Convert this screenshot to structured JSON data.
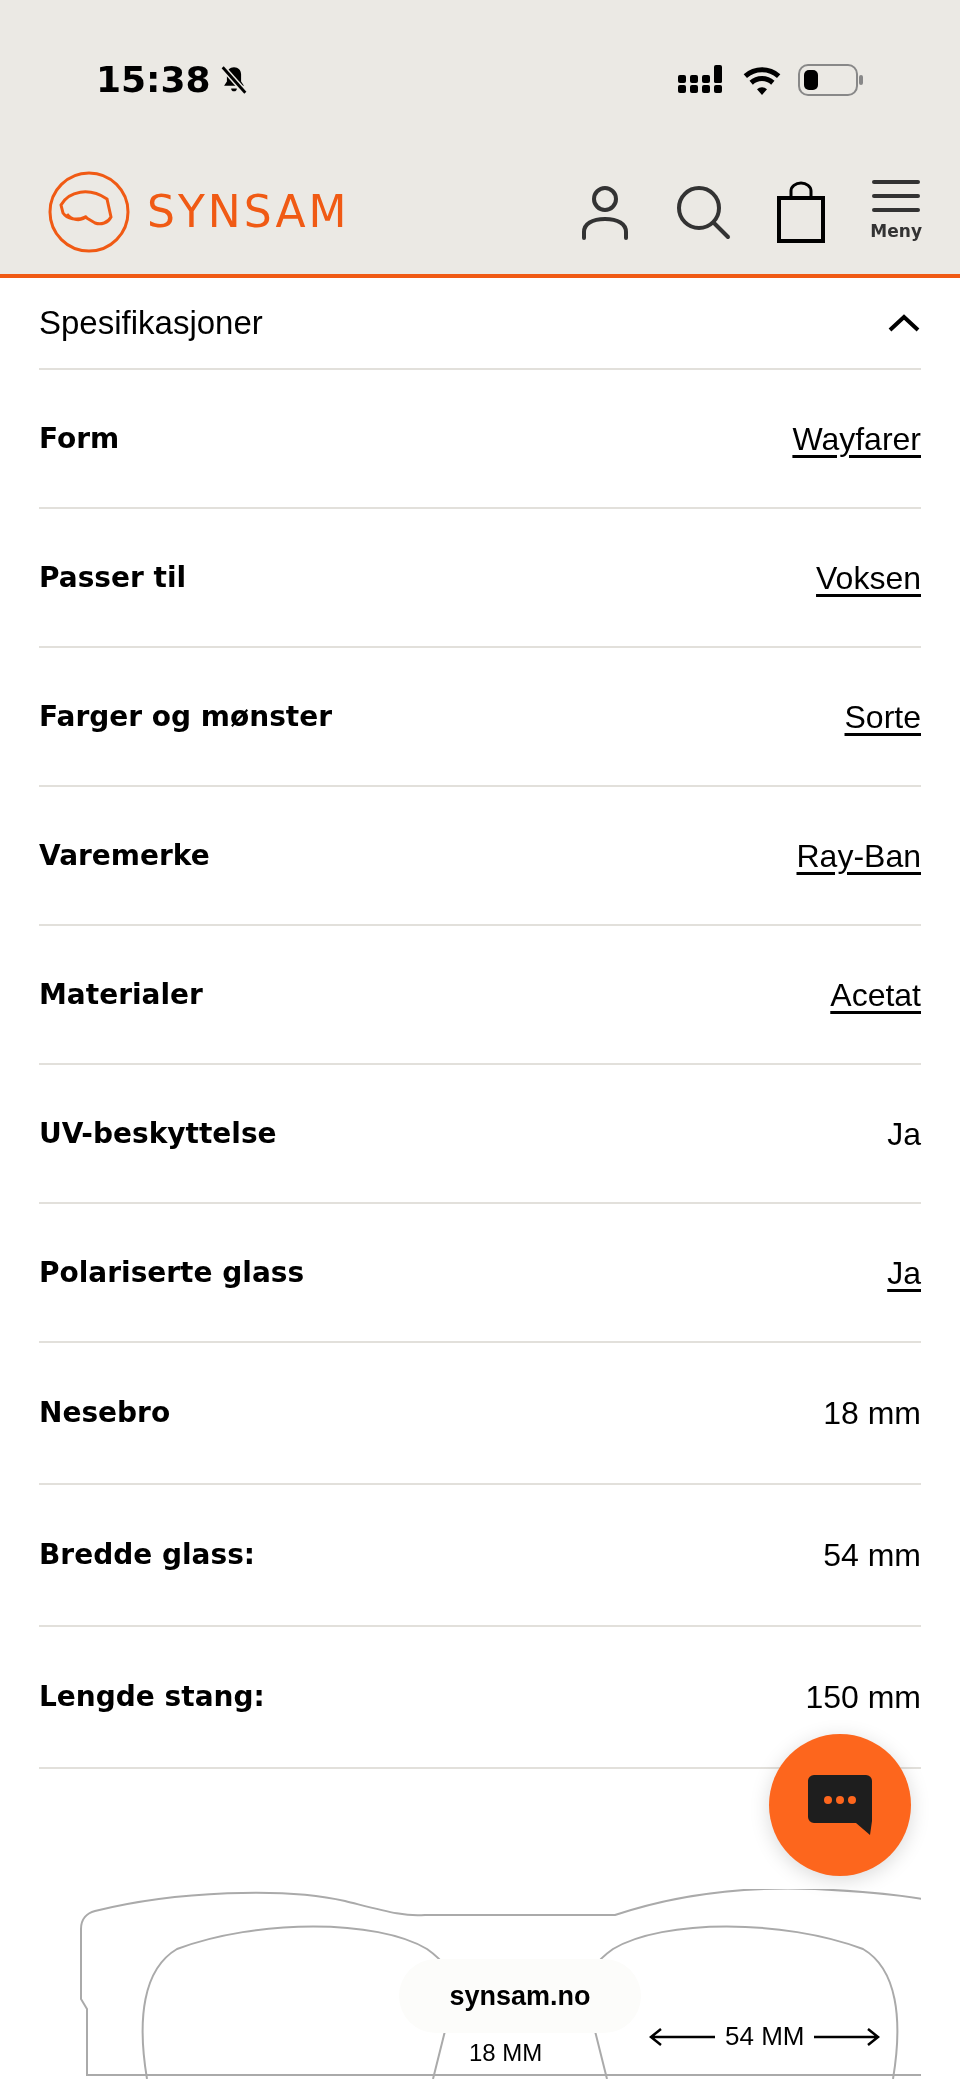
{
  "status_bar": {
    "time": "15:38",
    "silent": true
  },
  "header": {
    "logo_text": "SYNSAM",
    "menu_label": "Meny"
  },
  "section": {
    "title": "Spesifikasjoner",
    "expanded": true
  },
  "specs": [
    {
      "label": "Form",
      "value": "Wayfarer",
      "link": true
    },
    {
      "label": "Passer til",
      "value": "Voksen",
      "link": true
    },
    {
      "label": "Farger og mønster",
      "value": "Sorte",
      "link": true
    },
    {
      "label": "Varemerke",
      "value": "Ray-Ban",
      "link": true
    },
    {
      "label": "Materialer",
      "value": "Acetat",
      "link": true
    },
    {
      "label": "UV-beskyttelse",
      "value": "Ja",
      "link": false
    },
    {
      "label": "Polariserte glass",
      "value": "Ja",
      "link": true
    },
    {
      "label": "Nesebro",
      "value": "18 mm",
      "link": false
    },
    {
      "label": "Bredde glass:",
      "value": "54 mm",
      "link": false
    },
    {
      "label": "Lengde stang:",
      "value": "150 mm",
      "link": false
    }
  ],
  "measure_drawing": {
    "bridge_label": "18 MM",
    "lens_label": "54 MM"
  },
  "address_bar": {
    "url": "synsam.no"
  }
}
